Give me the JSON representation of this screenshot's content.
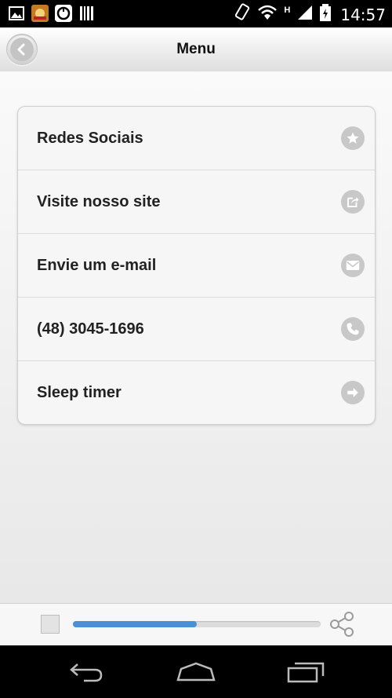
{
  "status": {
    "time": "14:57",
    "network_label": "H"
  },
  "header": {
    "title": "Menu"
  },
  "menu": {
    "items": [
      {
        "label": "Redes Sociais",
        "icon": "star-icon"
      },
      {
        "label": "Visite nosso site",
        "icon": "external-link-icon"
      },
      {
        "label": "Envie um e-mail",
        "icon": "mail-icon"
      },
      {
        "label": "(48) 3045-1696",
        "icon": "phone-icon"
      },
      {
        "label": "Sleep timer",
        "icon": "arrow-right-icon"
      }
    ]
  },
  "player": {
    "progress_percent": 50
  },
  "colors": {
    "accent": "#4a90d9",
    "icon_bg": "#c8c8c8"
  }
}
